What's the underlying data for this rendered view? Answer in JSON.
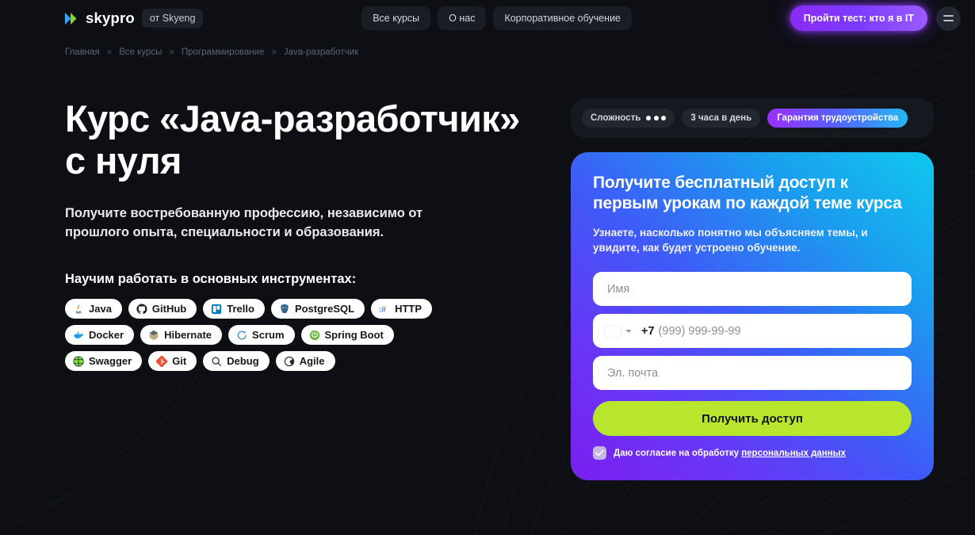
{
  "header": {
    "logo_text": "skypro",
    "logo_icon": "skypro-play-mark",
    "sub_brand": "от Skyeng",
    "nav": [
      {
        "label": "Все курсы",
        "name": "nav-all-courses"
      },
      {
        "label": "О нас",
        "name": "nav-about"
      },
      {
        "label": "Корпоративное обучение",
        "name": "nav-corporate"
      }
    ],
    "cta_label": "Пройти тест: кто я в IT",
    "menu_icon": "hamburger-menu-icon"
  },
  "breadcrumb": {
    "separator": "»",
    "items": [
      "Главная",
      "Все курсы",
      "Программирование",
      "Java-разработчик"
    ]
  },
  "hero": {
    "title": "Курс «Java-разработчик» с нуля",
    "lead": "Получите востребованную профессию, независимо от прошлого опыта, специальности и образования.",
    "tools_title": "Научим работать в основных инструментах:",
    "chips": [
      {
        "label": "Java",
        "icon": "java-icon"
      },
      {
        "label": "GitHub",
        "icon": "github-icon"
      },
      {
        "label": "Trello",
        "icon": "trello-icon"
      },
      {
        "label": "PostgreSQL",
        "icon": "postgresql-icon"
      },
      {
        "label": "HTTP",
        "icon": "http-icon"
      },
      {
        "label": "Docker",
        "icon": "docker-icon"
      },
      {
        "label": "Hibernate",
        "icon": "hibernate-icon"
      },
      {
        "label": "Scrum",
        "icon": "scrum-icon"
      },
      {
        "label": "Spring Boot",
        "icon": "spring-boot-icon"
      },
      {
        "label": "Swagger",
        "icon": "swagger-icon"
      },
      {
        "label": "Git",
        "icon": "git-icon"
      },
      {
        "label": "Debug",
        "icon": "debug-search-icon"
      },
      {
        "label": "Agile",
        "icon": "agile-icon"
      }
    ]
  },
  "badges": {
    "difficulty_label": "Сложность",
    "difficulty_dots": 3,
    "time_label": "3 часа в день",
    "guarantee_label": "Гарантия трудоустройства"
  },
  "form": {
    "title": "Получите бесплатный доступ к первым урокам по каждой теме курса",
    "description": "Узнаете, насколько понятно мы объясняем темы, и увидите, как будет устроено обучение.",
    "name_placeholder": "Имя",
    "phone_country": "RU",
    "phone_code": "+7",
    "phone_mask": "(999) 999-99-99",
    "email_placeholder": "Эл. почта",
    "submit_label": "Получить доступ",
    "consent_checked": true,
    "consent_text": "Даю согласие на обработку ",
    "consent_link": "персональных данных"
  },
  "colors": {
    "page_bg": "#0d0f14",
    "accent_green": "#B7E62C",
    "accent_purple": "#8B2BF5",
    "card_gradient_start": "#7A1FF0",
    "card_gradient_end": "#0FC8EF",
    "nav_chip_bg": "#1a1d24"
  }
}
